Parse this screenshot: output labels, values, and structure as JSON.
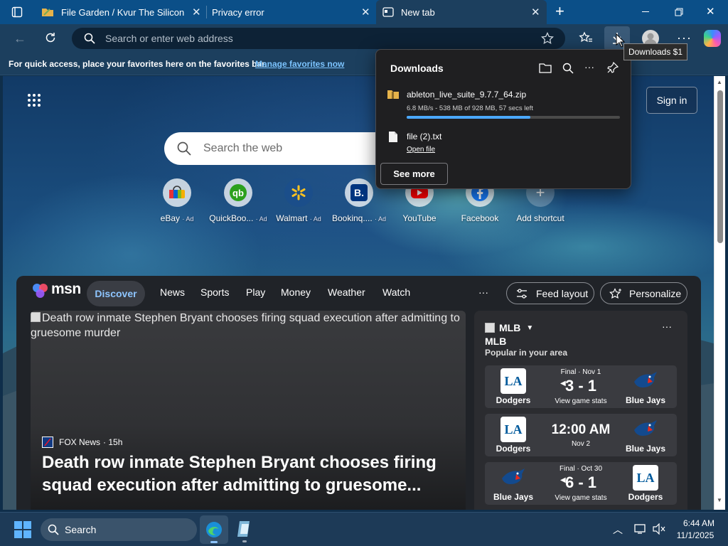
{
  "tabs": [
    {
      "title": "File Garden / Kvur The Silicon"
    },
    {
      "title": "Privacy error"
    },
    {
      "title": "New tab"
    }
  ],
  "toolbar": {
    "address_placeholder": "Search or enter web address"
  },
  "favorites_bar": {
    "message": "For quick access, place your favorites here on the favorites bar.",
    "link": "Manage favorites now"
  },
  "newtab": {
    "search_placeholder": "Search the web",
    "sign_in": "Sign in",
    "shortcuts": [
      {
        "label": "eBay",
        "ad": "· Ad",
        "color": "#e53238"
      },
      {
        "label": "QuickBoo...",
        "ad": "· Ad",
        "color": "#2ca01c"
      },
      {
        "label": "Walmart",
        "ad": "· Ad",
        "color": "#0071ce"
      },
      {
        "label": "Bookinq....",
        "ad": "· Ad",
        "color": "#003580"
      },
      {
        "label": "YouTube",
        "ad": "",
        "color": "#ff0000"
      },
      {
        "label": "Facebook",
        "ad": "",
        "color": "#1877f2"
      },
      {
        "label": "Add shortcut",
        "ad": "",
        "color": "#ffffff"
      }
    ]
  },
  "msn": {
    "brand": "msn",
    "nav": [
      "Discover",
      "News",
      "Sports",
      "Play",
      "Money",
      "Weather",
      "Watch"
    ],
    "more": "···",
    "feed_layout": "Feed layout",
    "personalize": "Personalize",
    "article": {
      "image_alt": "Death row inmate Stephen Bryant chooses firing squad execution after admitting to gruesome murder",
      "source": "FOX News",
      "age": "· 15h",
      "headline": "Death row inmate Stephen Bryant chooses firing squad execution after admitting to gruesome..."
    },
    "mlb": {
      "title": "MLB",
      "subtitle": "MLB",
      "caption": "Popular in your area",
      "games": [
        {
          "status": "Final · Nov 1",
          "score": "3 - 1",
          "link": "View game stats",
          "left_team": "Dodgers",
          "right_team": "Blue Jays"
        },
        {
          "status": "",
          "score": "12:00 AM",
          "link": "Nov 2",
          "left_team": "Dodgers",
          "right_team": "Blue Jays"
        },
        {
          "status": "Final · Oct 30",
          "score": "6 - 1",
          "link": "View game stats",
          "left_team": "Blue Jays",
          "right_team": "Dodgers"
        }
      ]
    }
  },
  "downloads": {
    "title": "Downloads",
    "items": [
      {
        "name": "ableton_live_suite_9.7.7_64.zip",
        "status": "6.8 MB/s - 538 MB of 928 MB, 57 secs left",
        "progress": 0.58
      },
      {
        "name": "file (2).txt",
        "action": "Open file"
      }
    ],
    "see_more": "See more"
  },
  "tooltip": "Downloads $1",
  "taskbar": {
    "search": "Search",
    "time": "6:44 AM",
    "date": "11/1/2025"
  },
  "colors": {
    "tabbar": "#0b4f88",
    "toolbar": "#1c3f5e",
    "accent_link": "#7cc4ff",
    "progress": "#4aa8ff"
  }
}
